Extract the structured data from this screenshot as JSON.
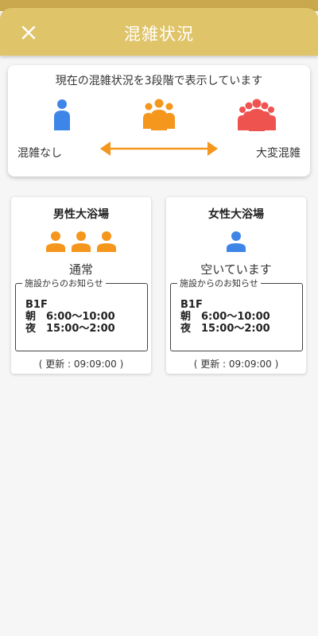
{
  "header": {
    "title": "混雑状況",
    "close_icon": "close-icon"
  },
  "legend": {
    "description": "現在の混雑状況を3段階で表示しています",
    "low_label": "混雑なし",
    "high_label": "大変混雑",
    "colors": {
      "low": "#3d86e8",
      "mid": "#f5961d",
      "high": "#ef5350"
    }
  },
  "baths": [
    {
      "name": "男性大浴場",
      "status": "通常",
      "level": 2,
      "notice_title": "施設からのお知らせ",
      "notice_lines": [
        "B1F",
        "朝　6:00〜10:00",
        "夜　15:00〜2:00"
      ],
      "updated": "( 更新 : 09:09:00 )"
    },
    {
      "name": "女性大浴場",
      "status": "空いています",
      "level": 1,
      "notice_title": "施設からのお知らせ",
      "notice_lines": [
        "B1F",
        "朝　6:00〜10:00",
        "夜　15:00〜2:00"
      ],
      "updated": "( 更新 : 09:09:00 )"
    }
  ]
}
